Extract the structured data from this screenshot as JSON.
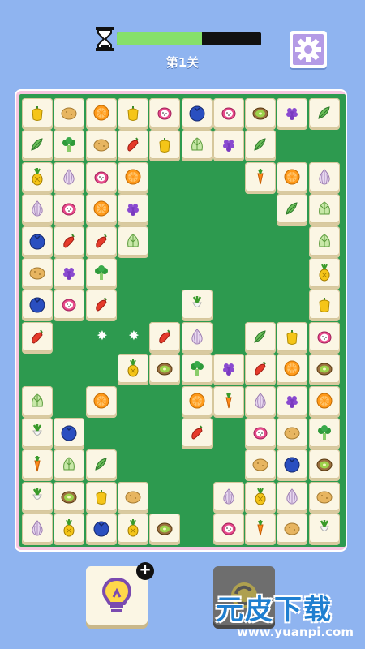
{
  "hud": {
    "level_label": "第1关",
    "timer_progress": 0.59,
    "icons": {
      "timer": "hourglass-icon",
      "settings": "gear-icon"
    }
  },
  "board": {
    "cols": 10,
    "rows": 14,
    "tiles": [
      [
        "pepper-yellow",
        "potato",
        "orange",
        "pepper-yellow",
        "dragonfruit",
        "blueberry",
        "dragonfruit",
        "kiwi",
        "grape",
        "spinach"
      ],
      [
        "spinach",
        "broccoli",
        "potato",
        "pepper-red",
        "pepper-yellow",
        "cabbage",
        "grape",
        "spinach",
        "",
        ""
      ],
      [
        "pineapple",
        "onion",
        "dragonfruit",
        "orange",
        "",
        "",
        "",
        "carrot",
        "orange",
        "onion"
      ],
      [
        "onion",
        "dragonfruit",
        "orange",
        "grape",
        "",
        "",
        "",
        "",
        "spinach",
        "cabbage"
      ],
      [
        "blueberry",
        "pepper-red",
        "pepper-red",
        "cabbage",
        "",
        "",
        "",
        "",
        "",
        "cabbage"
      ],
      [
        "potato",
        "grape",
        "broccoli",
        "",
        "",
        "",
        "",
        "",
        "",
        "pineapple"
      ],
      [
        "blueberry",
        "dragonfruit",
        "pepper-red",
        "",
        "",
        "radish",
        "",
        "",
        "",
        "pepper-yellow"
      ],
      [
        "pepper-red",
        "",
        "",
        "",
        "pepper-red",
        "onion",
        "",
        "spinach",
        "pepper-yellow",
        "dragonfruit"
      ],
      [
        "",
        "",
        "",
        "pineapple",
        "kiwi",
        "broccoli",
        "grape",
        "pepper-red",
        "orange",
        "kiwi"
      ],
      [
        "cabbage",
        "",
        "orange",
        "",
        "",
        "orange",
        "carrot",
        "onion",
        "grape",
        "orange"
      ],
      [
        "radish",
        "blueberry",
        "",
        "",
        "",
        "pepper-red",
        "",
        "dragonfruit",
        "potato",
        "broccoli"
      ],
      [
        "carrot",
        "cabbage",
        "spinach",
        "",
        "",
        "",
        "",
        "potato",
        "blueberry",
        "kiwi"
      ],
      [
        "radish",
        "kiwi",
        "pepper-yellow",
        "potato",
        "",
        "",
        "onion",
        "pineapple",
        "onion",
        "potato"
      ],
      [
        "onion",
        "pineapple",
        "blueberry",
        "pineapple",
        "kiwi",
        "",
        "dragonfruit",
        "carrot",
        "potato",
        "radish"
      ]
    ]
  },
  "buttons": {
    "hint_icon": "lightbulb-icon",
    "hint_plus": "+",
    "shuffle_icon": "shuffle-icon"
  },
  "watermark": {
    "main": "元皮下载",
    "url": "www.yuanpi.com"
  },
  "colors": {
    "background": "#8fb4f0",
    "board_border": "#f7c6e0",
    "board_green": "#2d9a4f",
    "tile": "#fbf6e4",
    "timer_fill": "#86e06a"
  }
}
